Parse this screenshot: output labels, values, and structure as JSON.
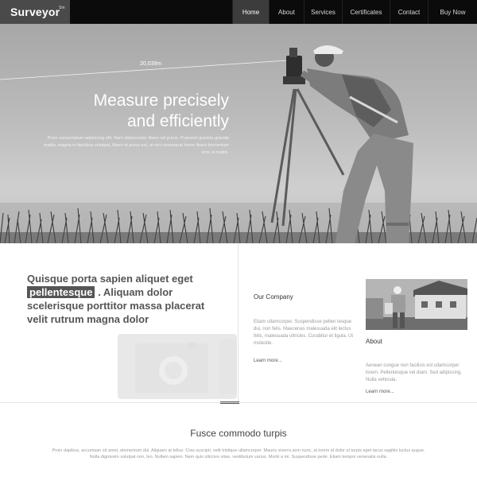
{
  "header": {
    "logo": "Surveyor",
    "logo_sup": "Sm",
    "nav": [
      {
        "label": "Home"
      },
      {
        "label": "About"
      },
      {
        "label": "Services"
      },
      {
        "label": "Certificates"
      },
      {
        "label": "Contact"
      },
      {
        "label": "Buy Now"
      }
    ]
  },
  "hero": {
    "distance": "20,039m",
    "title_line1": "Measure precisely",
    "title_line2": "and efficiently",
    "paragraph": "Proin consectetuer adipiscing elit. Nam ullamcorper libero vel purus. Praesent gravida gravida mattis, magna in faucibus volutpat, libero et purus est, at orci consequat lorem libero fermentum eros ut mattis."
  },
  "intro": {
    "quote_before": "Quisque porta sapien aliquet eget",
    "quote_highlight": "pellentesque",
    "quote_after": ". Aliquam dolor scelerisque porttitor massa placerat velit rutrum magna dolor"
  },
  "company": {
    "title": "Our Company",
    "text": "Etiam ullamcorper. Suspendisse pellen tesque dui, non felis. Maecenas malesuada elit lectus felis, malesuada ultricies. Curabitur et ligula. Ut molestie.",
    "more": "Learn more..."
  },
  "about": {
    "title": "About",
    "text": "Aenean congue non facilisis est ullamcorper lorem. Pellentesque vel diam. Sed adipiscing. Nulla vehicula.",
    "more": "Learn more..."
  },
  "bottom": {
    "title": "Fusce commodo turpis",
    "text": "Proin dapibus, accumsan sit amet, elementum dui. Aliquam at tellus. Cras suscipit, velit tristique ullamcorper. Mauris viverra sem nunc, at lorem id dolor ut turpis eget lacus sagittis luctus augue. Nulla dignissim volutpat non, leo. Nullam sapien. Nam quis ultricies vitae, vestibulum varius. Morbi a mi. Suspendisse pede. Etiam tempor venenatis nulla."
  }
}
